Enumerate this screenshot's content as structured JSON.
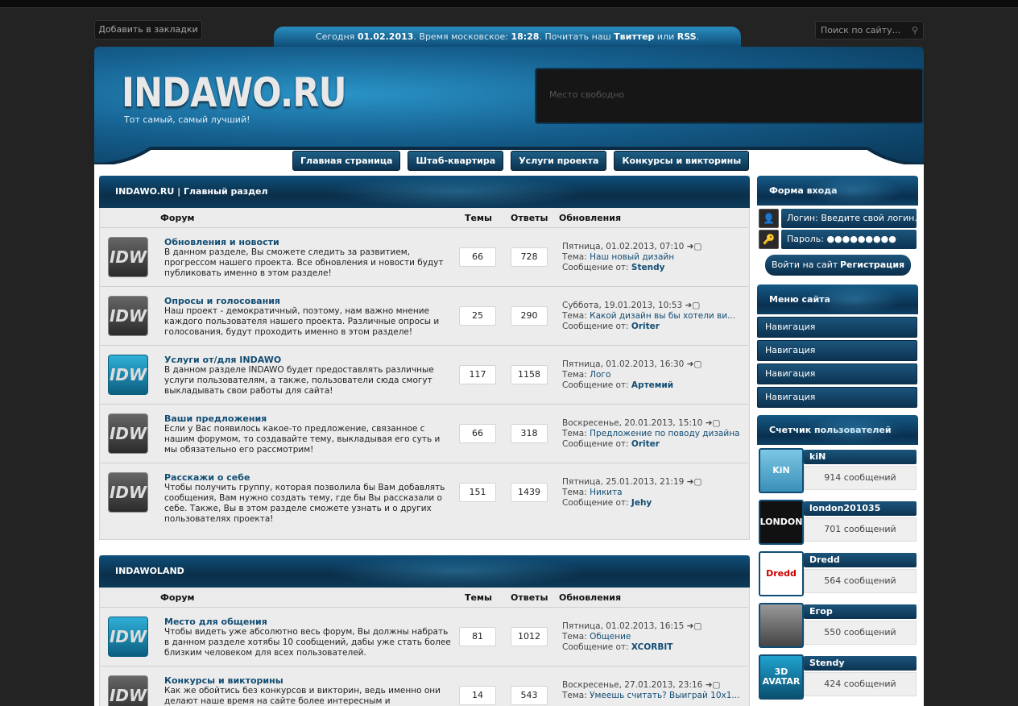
{
  "top": {
    "bookmark_label": "Добавить в закладки",
    "search_placeholder": "Поиск по сайту...",
    "info_prefix": "Сегодня ",
    "info_date": "01.02.2013",
    "info_mid": ". Время московское: ",
    "info_time": "18:28",
    "info_mid2": ". Почитать наш ",
    "info_twitter": "Твиттер",
    "info_or": " или ",
    "info_rss": "RSS",
    "info_end": "."
  },
  "header": {
    "logo": "INDAWO.RU",
    "slogan": "Тот самый, самый лучший!",
    "ad_text": "Место свободно"
  },
  "nav": [
    {
      "label": "Главная страница"
    },
    {
      "label": "Штаб-квартира"
    },
    {
      "label": "Услуги проекта"
    },
    {
      "label": "Конкурсы и викторины"
    }
  ],
  "columns": {
    "forum": "Форум",
    "topics": "Темы",
    "replies": "Ответы",
    "updates": "Обновления"
  },
  "categories": [
    {
      "title": "INDAWO.RU | Главный раздел",
      "forums": [
        {
          "icon": "IDW",
          "title": "Обновления и новости",
          "desc": "В данном разделе, Вы сможете следить за развитием, прогрессом нашего проекта. Все обновления и новости будут публиковать именно в этом разделе!",
          "topics": "66",
          "replies": "728",
          "upd_date": "Пятница, 01.02.2013, 07:10",
          "upd_topic_label": "Тема: ",
          "upd_topic": "Наш новый дизайн",
          "upd_from_label": "Сообщение от: ",
          "upd_from": "Stendy"
        },
        {
          "icon": "IDW",
          "title": "Опросы и голосования",
          "desc": "Наш проект - демократичный, поэтому, нам важно мнение каждого пользователя нашего проекта. Различные опросы и голосования, будут проходить именно в этом разделе!",
          "topics": "25",
          "replies": "290",
          "upd_date": "Суббота, 19.01.2013, 10:53",
          "upd_topic_label": "Тема: ",
          "upd_topic": "Какой дизайн вы бы хотели ви...",
          "upd_from_label": "Сообщение от: ",
          "upd_from": "Oriter"
        },
        {
          "icon": "IDW",
          "title": "Услуги от/для INDAWO",
          "desc": "В данном разделе INDAWO будет предоставлять различные услуги пользователям, а также, пользователи сюда смогут выкладывать свои работы для сайта!",
          "topics": "117",
          "replies": "1158",
          "upd_date": "Пятница, 01.02.2013, 16:30",
          "upd_topic_label": "Тема: ",
          "upd_topic": "Лого",
          "upd_from_label": "Сообщение от: ",
          "upd_from": "Артемий"
        },
        {
          "icon": "IDW",
          "title": "Ваши предложения",
          "desc": "Если у Вас появилось какое-то предложение, связанное с нашим форумом, то создавайте тему, выкладывая его суть и мы обязательно его рассмотрим!",
          "topics": "66",
          "replies": "318",
          "upd_date": "Воскресенье, 20.01.2013, 15:10",
          "upd_topic_label": "Тема: ",
          "upd_topic": "Предложение по поводу дизайна",
          "upd_from_label": "Сообщение от: ",
          "upd_from": "Oriter"
        },
        {
          "icon": "IDW",
          "title": "Расскажи о себе",
          "desc": "Чтобы получить группу, которая позволила бы Вам добавлять сообщения, Вам нужно создать тему, где бы Вы рассказали о себе. Также, Вы в этом разделе сможете узнать и о других пользователях проекта!",
          "topics": "151",
          "replies": "1439",
          "upd_date": "Пятница, 25.01.2013, 21:19",
          "upd_topic_label": "Тема: ",
          "upd_topic": "Никита",
          "upd_from_label": "Сообщение от: ",
          "upd_from": "Jehy"
        }
      ]
    },
    {
      "title": "INDAWOLAND",
      "forums": [
        {
          "icon": "IDW",
          "title": "Место для общения",
          "desc": "Чтобы видеть уже абсолютно весь форум, Вы должны набрать в данном разделе хотябы 10 сообщений, дабы уже стать более близким человеком для всех пользователей.",
          "topics": "81",
          "replies": "1012",
          "upd_date": "Пятница, 01.02.2013, 16:15",
          "upd_topic_label": "Тема: ",
          "upd_topic": "Общение",
          "upd_from_label": "Сообщение от: ",
          "upd_from": "XCORBIT"
        },
        {
          "icon": "IDW",
          "title": "Конкурсы и викторины",
          "desc": "Как же обойтись без конкурсов и викторин, ведь именно они делают наше время на сайте более интересным и увлекательным!",
          "topics": "14",
          "replies": "543",
          "upd_date": "Воскресенье, 27.01.2013, 23:16",
          "upd_topic_label": "Тема: ",
          "upd_topic": "Умеешь считать? Выиграй 10x1...",
          "upd_from_label": "",
          "upd_from": ""
        }
      ]
    }
  ],
  "sidebar": {
    "login_title": "Форма входа",
    "login_field": "Логин: Введите свой логин...",
    "password_field": "Пароль: ●●●●●●●●●",
    "login_button": "Войти на сайт",
    "register_button": "Регистрация",
    "menu_title": "Меню сайта",
    "menu_items": [
      "Навигация",
      "Навигация",
      "Навигация",
      "Навигация"
    ],
    "counter_title": "Счетчик пользователей",
    "users": [
      {
        "name": "kiN",
        "messages": "914 сообщений",
        "avatar_text": "KiN"
      },
      {
        "name": "london201035",
        "messages": "701 сообщений",
        "avatar_text": "LONDON"
      },
      {
        "name": "Dredd",
        "messages": "564 сообщений",
        "avatar_text": "Dredd"
      },
      {
        "name": "Егор",
        "messages": "550 сообщений",
        "avatar_text": ""
      },
      {
        "name": "Stendy",
        "messages": "424 сообщений",
        "avatar_text": "3D AVATAR"
      }
    ]
  },
  "colors": {
    "accent": "#124d73",
    "header_dark": "#0a3050",
    "header_light": "#2a93c7",
    "page_bg": "#232323"
  }
}
